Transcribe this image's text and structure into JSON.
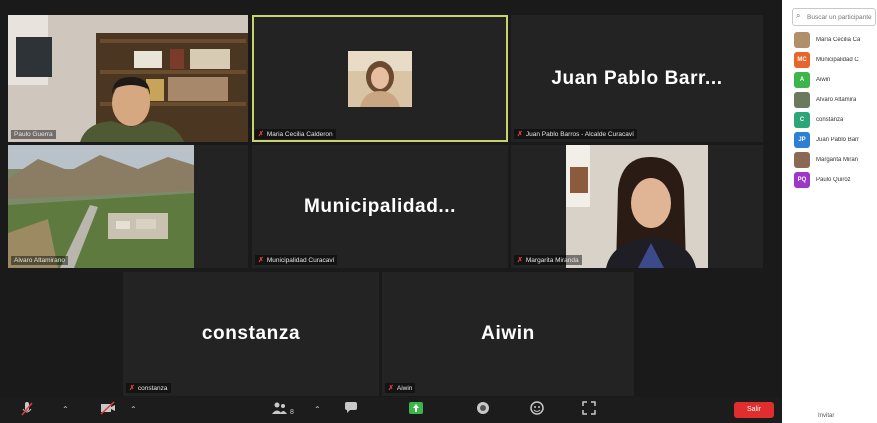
{
  "search": {
    "placeholder": "Buscar un participante"
  },
  "tiles": {
    "paulo": {
      "name": "Paulo Guerra"
    },
    "maria": {
      "name": "Maria Cecilia Calderon"
    },
    "juan": {
      "display": "Juan Pablo Barr...",
      "name": "Juan Pablo Barros - Alcalde Curacaví"
    },
    "alvaro": {
      "name": "Alvaro Altamirano"
    },
    "muni": {
      "display": "Municipalidad...",
      "name": "Municipalidad Curacaví"
    },
    "margarita": {
      "name": "Margarita Miranda"
    },
    "constanza": {
      "display": "constanza",
      "name": "constanza"
    },
    "aiwin": {
      "display": "Aiwin",
      "name": "Aiwin"
    }
  },
  "participants": [
    {
      "initials": "",
      "name": "María Cecilia Ca",
      "color": "#b08f6a",
      "photo": true
    },
    {
      "initials": "MC",
      "name": "Municipalidad C",
      "color": "#e8642b"
    },
    {
      "initials": "A",
      "name": "Aiwin",
      "color": "#3cb54a"
    },
    {
      "initials": "",
      "name": "Alvaro Altamira",
      "color": "#6b7a5e",
      "photo": true
    },
    {
      "initials": "C",
      "name": "constanza",
      "color": "#2aa67a"
    },
    {
      "initials": "JP",
      "name": "Juan Pablo Barr",
      "color": "#2d7fd3"
    },
    {
      "initials": "",
      "name": "Margarita Miran",
      "color": "#8a6a55",
      "photo": true
    },
    {
      "initials": "PQ",
      "name": "Paulo Quiroz",
      "color": "#9b36c9"
    }
  ],
  "toolbar": {
    "participants_count": "8",
    "leave_label": "Salir"
  },
  "panel_footer": {
    "invite_label": "Invitar"
  },
  "colors": {
    "mic_muted": "#e03c3c",
    "leave_red": "#e02d2d",
    "active_speaker": "#c9d36a"
  }
}
